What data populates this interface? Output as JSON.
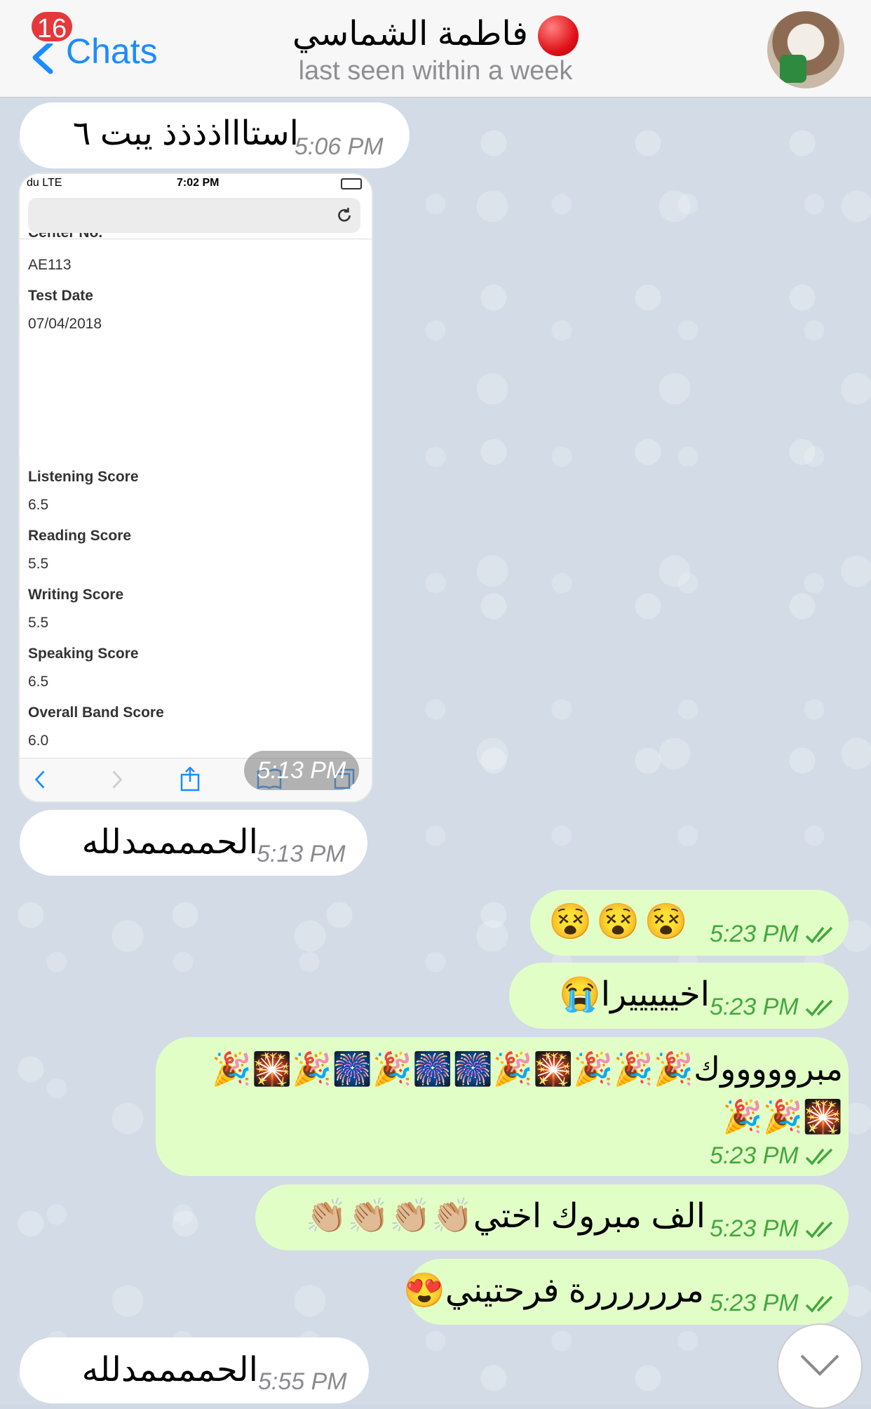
{
  "header": {
    "back_label": "Chats",
    "unread_count": "16",
    "contact_name": "فاطمة الشماسي",
    "status": "last seen within a week"
  },
  "shared_screenshot": {
    "status_carrier": "du  LTE",
    "status_time": "7:02 PM",
    "cutoff_label": "Center No.",
    "fields": [
      {
        "label": "",
        "value": "AE113"
      },
      {
        "label": "Test Date",
        "value": "07/04/2018"
      },
      {
        "label": "Listening Score",
        "value": "6.5"
      },
      {
        "label": "Reading Score",
        "value": "5.5"
      },
      {
        "label": "Writing Score",
        "value": "5.5"
      },
      {
        "label": "Speaking Score",
        "value": "6.5"
      },
      {
        "label": "Overall Band Score",
        "value": "6.0"
      }
    ]
  },
  "messages": [
    {
      "direction": "in",
      "text": "استاااذذذذ يبت ٦",
      "time": "5:06 PM"
    },
    {
      "direction": "in",
      "type": "image",
      "time": "5:13 PM"
    },
    {
      "direction": "in",
      "text": "الحممممدلله",
      "time": "5:13 PM"
    },
    {
      "direction": "out",
      "text": "😵😵😵",
      "time": "5:23 PM"
    },
    {
      "direction": "out",
      "text": "اخيييييرا😭",
      "time": "5:23 PM"
    },
    {
      "direction": "out",
      "text": "مبروووووك🎉🎉🎉🎇🎉🎆🎆🎉🎆🎉🎇🎉",
      "line2": "🎇🎉🎉",
      "time": "5:23 PM"
    },
    {
      "direction": "out",
      "text": "الف مبروك اختي👏🏼👏🏼👏🏼👏🏼",
      "time": "5:23 PM"
    },
    {
      "direction": "out",
      "text": "مررررررة فرحتيني😍",
      "time": "5:23 PM"
    },
    {
      "direction": "in",
      "text": "الحممممدلله",
      "time": "5:55 PM"
    }
  ],
  "colors": {
    "accent": "#1a8cff",
    "badge": "#e5383b",
    "outgoing_bubble": "#e2fec7",
    "outgoing_time": "#42a83d",
    "incoming_bubble": "#ffffff"
  }
}
